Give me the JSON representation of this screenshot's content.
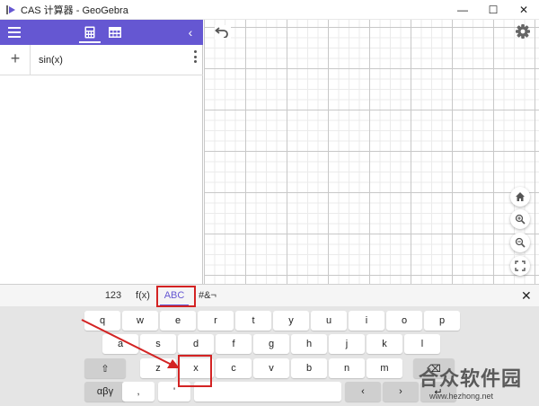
{
  "window": {
    "title": "CAS 计算器 - GeoGebra",
    "controls": [
      "—",
      "☐",
      "✕"
    ]
  },
  "algebra": {
    "collapse_glyph": "‹",
    "add_glyph": "+",
    "input_expression": "sin(x)"
  },
  "keyboard": {
    "tabs": [
      "123",
      "f(x)",
      "ABC",
      "#&¬"
    ],
    "active_tab": "ABC",
    "close_glyph": "✕",
    "row1": [
      "q",
      "w",
      "e",
      "r",
      "t",
      "y",
      "u",
      "i",
      "o",
      "p"
    ],
    "row2": [
      "a",
      "s",
      "d",
      "f",
      "g",
      "h",
      "j",
      "k",
      "l"
    ],
    "row3": [
      "z",
      "x",
      "c",
      "v",
      "b",
      "n",
      "m"
    ],
    "shift_glyph": "⇧",
    "backspace_glyph": "⌫",
    "greek_label": "αβγ",
    "comma": ",",
    "apostrophe": "'",
    "left_arrow": "‹",
    "right_arrow": "›",
    "enter_glyph": "↵"
  },
  "annotations": {
    "highlight_color": "#d32323",
    "highlighted": [
      "ABC",
      "x"
    ]
  },
  "watermark": {
    "title": "合众软件园",
    "url": "www.hezhong.net"
  },
  "colors": {
    "accent": "#6557d2",
    "annotation": "#d32323"
  }
}
